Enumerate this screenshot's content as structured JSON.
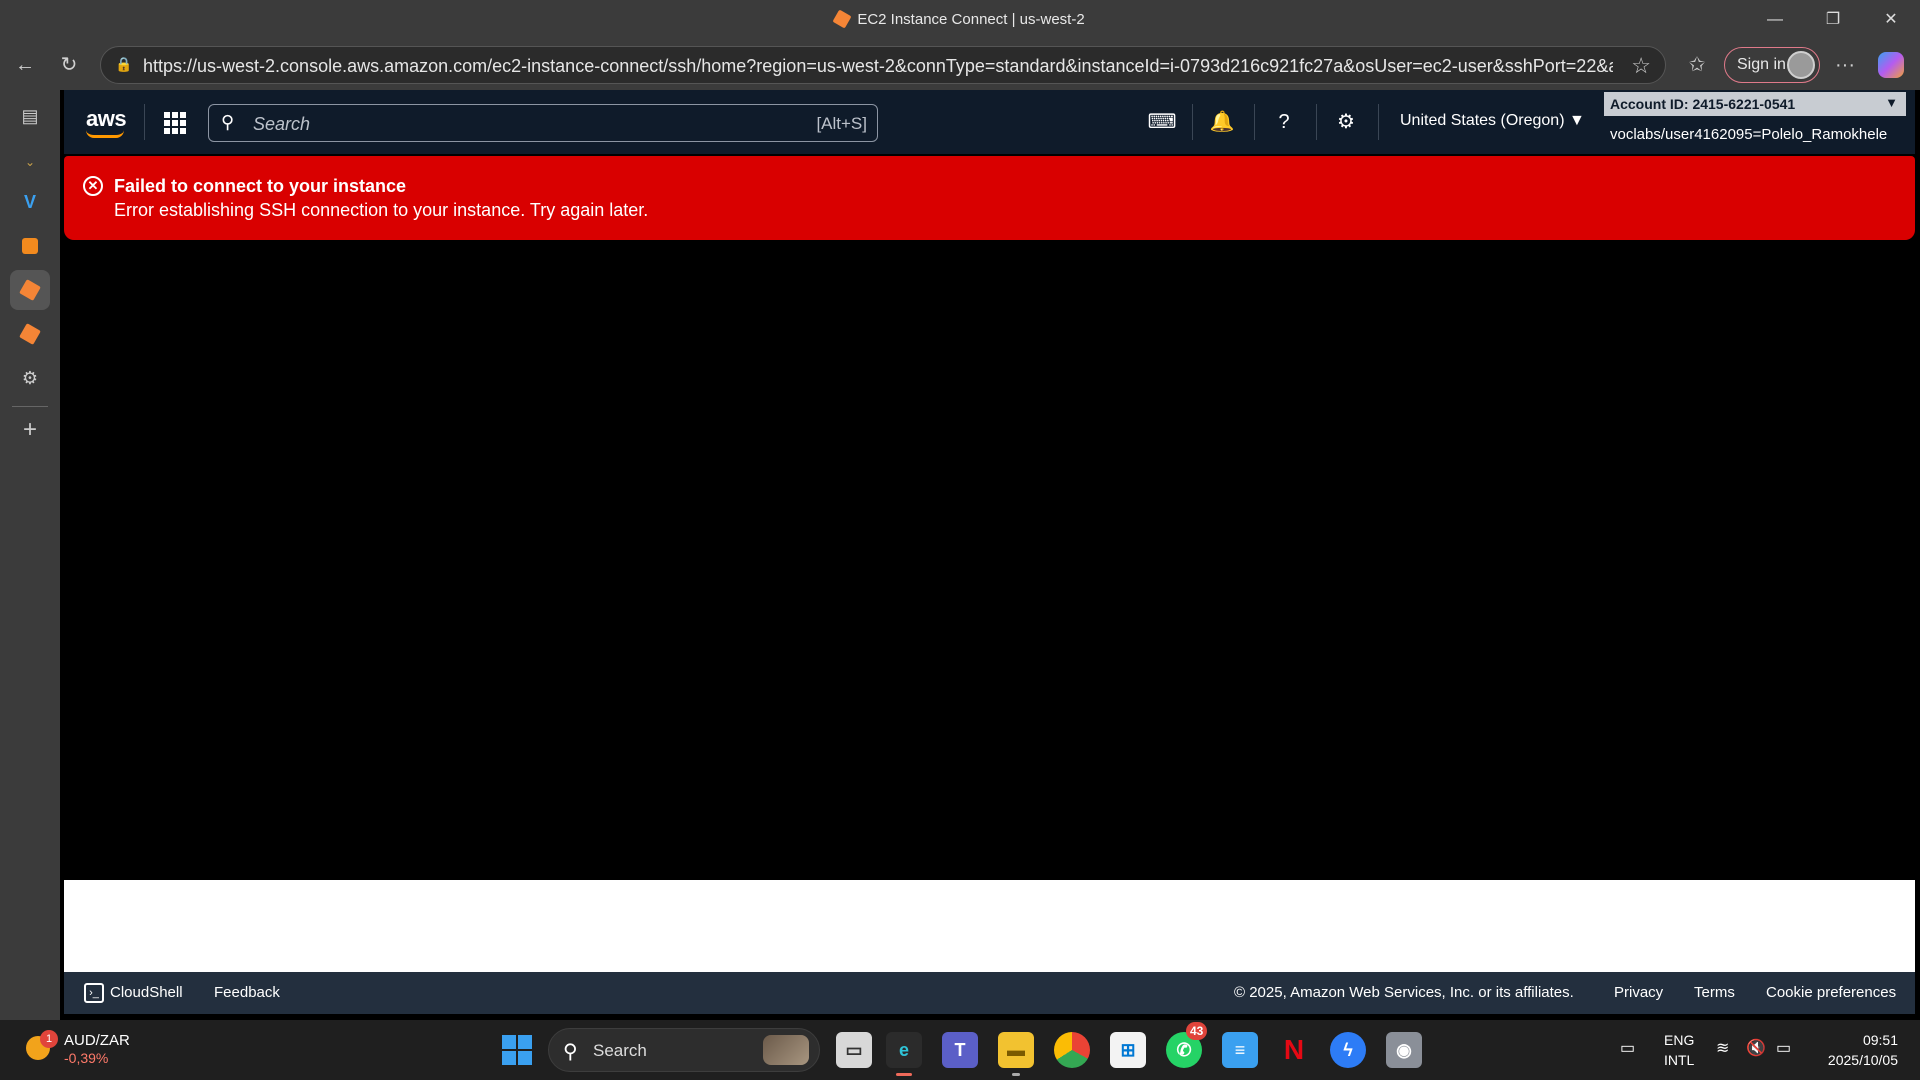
{
  "window": {
    "title": "EC2 Instance Connect | us-west-2",
    "minimize": "—",
    "maximize": "❐",
    "close": "✕"
  },
  "browser": {
    "url": "https://us-west-2.console.aws.amazon.com/ec2-instance-connect/ssh/home?region=us-west-2&connType=standard&instanceId=i-0793d216c921fc27a&osUser=ec2-user&sshPort=22&addr...",
    "signin_label": "Sign in",
    "more_label": "···"
  },
  "aws_nav": {
    "logo": "aws",
    "search_placeholder": "Search",
    "search_shortcut": "[Alt+S]",
    "region": "United States (Oregon) ▼",
    "account_id": "Account ID: 2415-6221-0541",
    "user_role": "voclabs/user4162095=Polelo_Ramokhele"
  },
  "error": {
    "title": "Failed to connect to your instance",
    "message": "Error establishing SSH connection to your instance. Try again later."
  },
  "footer": {
    "cloudshell": "CloudShell",
    "feedback": "Feedback",
    "copyright": "© 2025, Amazon Web Services, Inc. or its affiliates.",
    "privacy": "Privacy",
    "terms": "Terms",
    "cookie": "Cookie preferences"
  },
  "taskbar": {
    "weather_badge": "1",
    "ticker": "AUD/ZAR",
    "ticker_change": "-0,39%",
    "search_label": "Search",
    "whatsapp_badge": "43",
    "lang_top": "ENG",
    "lang_bottom": "INTL",
    "time": "09:51",
    "date": "2025/10/05"
  },
  "colors": {
    "error_red": "#d90000",
    "aws_nav_bg": "#0f1b2a",
    "aws_orange": "#ff9900",
    "footer_bg": "#232f3e"
  }
}
